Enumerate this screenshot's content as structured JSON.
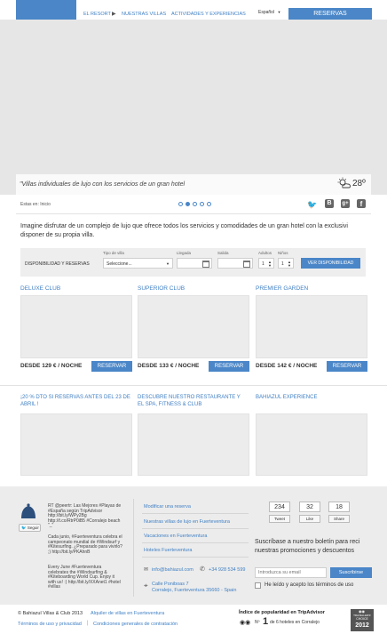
{
  "nav": {
    "items": [
      "EL RESORT",
      "NUESTRAS VILLAS",
      "ACTIVIDADES Y EXPERIENCIAS"
    ],
    "arrow": "▶",
    "language": "Español",
    "reserve_label": "RESERVAS"
  },
  "hero": {
    "tagline": "\"Villas individuales de lujo con los servicios de un gran hotel",
    "weather_temp": "28º",
    "weather_icon": "sun-cloud-icon"
  },
  "crumb": {
    "text": "Estas en: Inicio",
    "dots": 5,
    "active_dot": 1
  },
  "intro": {
    "text": "Imagine disfrutar de un complejo de lujo que ofrece todos los servicios y comodidades de un gran hotel con la exclusivi disponer de su propia villa."
  },
  "booking": {
    "title": "DISPONIBILIDAD Y RESERVAS",
    "type_label": "Tipo de villa",
    "type_value": "Seleccione...",
    "arrival_label": "Llegada",
    "departure_label": "Salida",
    "adults_label": "Adultos",
    "adults_value": "1",
    "kids_label": "Niños",
    "kids_value": "1",
    "submit_label": "VER DISPONIBILIDAD"
  },
  "villas": [
    {
      "title": "DELUXE CLUB",
      "price": "DESDE 129 € / NOCHE",
      "button": "RESERVAR"
    },
    {
      "title": "SUPERIOR CLUB",
      "price": "DESDE 133 € / NOCHE",
      "button": "RESERVAR"
    },
    {
      "title": "PREMIER GARDEN",
      "price": "DESDE 142 € / NOCHE",
      "button": "RESERVAR"
    }
  ],
  "promos": [
    {
      "title": "¡20 % DTO SI RESERVAS ANTES DEL 23 DE ABRIL !"
    },
    {
      "title": "DESCUBRE NUESTRO RESTAURANTE Y EL SPA, FITNESS & CLUB"
    },
    {
      "title": "BAHIAZUL EXPERIENCE"
    }
  ],
  "footer": {
    "twitter_label": "Seguir",
    "tweets": [
      "RT @peertr: Las Mejores #Playas de #España según TripAdvisor http://bit.ly/WPy2Bg http://t.co/RtrP0iB5 #Corralejo beach \"_\"",
      "Cada junio, #Fuerteventura celebra el campeonato mundial de #Windsurf y #Kitesurfing. ¿Preparado para vivirlo? ;) http://bit.ly/PKAhnB",
      "Every June #Fuerteventura celebrates the #Windsurfing & #Kiteboarding World Cup. Enjoy it with us! :) http://bit.ly/XXAnet1 #hotel #villas"
    ],
    "links": [
      "Modificar una reserva",
      "Nuestras villas de lujo en Fuerteventura",
      "Vacaciones en Fuerteventura",
      "Hoteles Fuerteventura"
    ],
    "email": "info@bahiazul.com",
    "phone": "+34 928 534 599",
    "address_line1": "Calle Poniboas 7",
    "address_line2": "Corralejo, Fuerteventura 35660 - Spain",
    "social_counts": [
      {
        "count": "234",
        "label": "Tweet"
      },
      {
        "count": "32",
        "label": "Like"
      },
      {
        "count": "18",
        "label": "Share"
      }
    ],
    "newsletter_text": "Suscríbase a nuestro boletín para reci nuestras promociones y descuentos",
    "email_placeholder": "Introduzca su email",
    "subscribe_label": "Suscribirse",
    "terms_label": "He leído y acepto los términos de uso"
  },
  "bottom": {
    "copyright": "© Bahiazul Villas & Club 2013",
    "link1": "Alquiler de villas en Fuerteventura",
    "link2": "Términos de uso y privacidad",
    "link3": "Condiciones generales de contratación",
    "ta_title": "Índice de popularidad en TripAdvisor",
    "ta_rank_prefix": "Nº",
    "ta_rank": "1",
    "ta_rank_suffix": "de 6 hoteles en Corralejo",
    "award_line1": "TRAVELLERS'",
    "award_line2": "CHOICE",
    "award_year": "2012"
  }
}
